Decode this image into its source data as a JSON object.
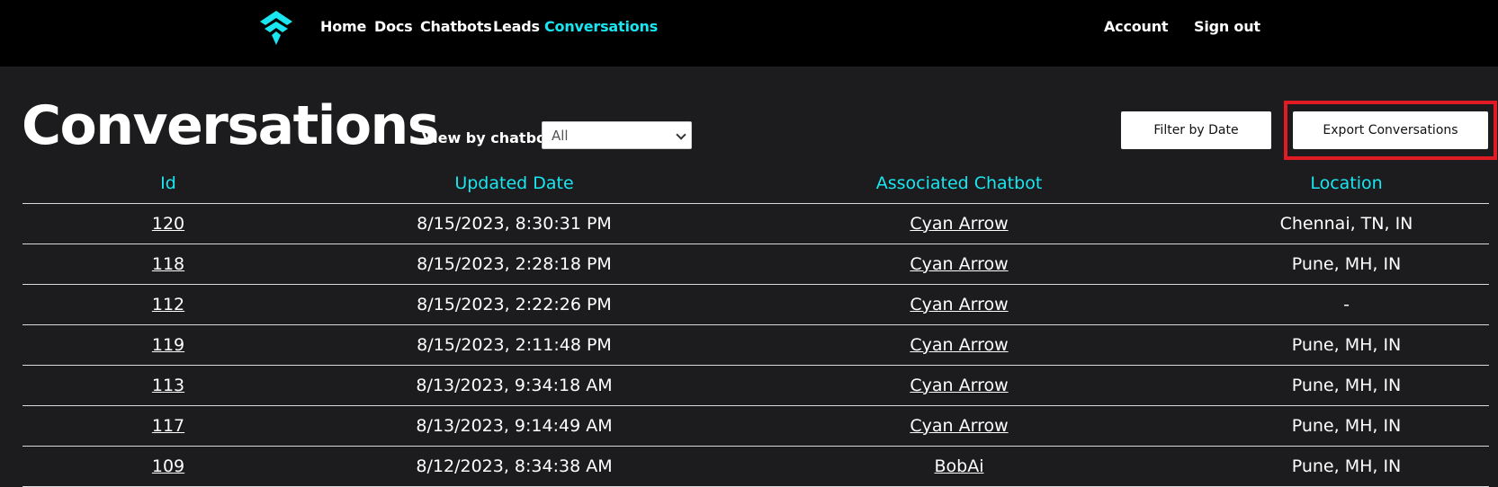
{
  "nav": {
    "links": [
      {
        "label": "Home",
        "active": false
      },
      {
        "label": "Docs",
        "active": false
      },
      {
        "label": "Chatbots",
        "active": false
      },
      {
        "label": "Leads",
        "active": false
      },
      {
        "label": "Conversations",
        "active": true
      }
    ],
    "account_label": "Account",
    "signout_label": "Sign out",
    "logo_icon": "arrow-logo-icon"
  },
  "page": {
    "title": "Conversations",
    "view_by_label": "View by chatbot",
    "chatbot_select_value": "All",
    "filter_button_label": "Filter by Date",
    "export_button_label": "Export Conversations"
  },
  "table": {
    "headers": [
      "Id",
      "Updated Date",
      "Associated Chatbot",
      "Location"
    ],
    "rows": [
      {
        "id": "120",
        "updated": "8/15/2023, 8:30:31 PM",
        "chatbot": "Cyan Arrow",
        "location": "Chennai, TN, IN"
      },
      {
        "id": "118",
        "updated": "8/15/2023, 2:28:18 PM",
        "chatbot": "Cyan Arrow",
        "location": "Pune, MH, IN"
      },
      {
        "id": "112",
        "updated": "8/15/2023, 2:22:26 PM",
        "chatbot": "Cyan Arrow",
        "location": "-"
      },
      {
        "id": "119",
        "updated": "8/15/2023, 2:11:48 PM",
        "chatbot": "Cyan Arrow",
        "location": "Pune, MH, IN"
      },
      {
        "id": "113",
        "updated": "8/13/2023, 9:34:18 AM",
        "chatbot": "Cyan Arrow",
        "location": "Pune, MH, IN"
      },
      {
        "id": "117",
        "updated": "8/13/2023, 9:14:49 AM",
        "chatbot": "Cyan Arrow",
        "location": "Pune, MH, IN"
      },
      {
        "id": "109",
        "updated": "8/12/2023, 8:34:38 AM",
        "chatbot": "BobAi",
        "location": "Pune, MH, IN"
      }
    ]
  },
  "colors": {
    "accent": "#19e6f0",
    "background": "#1c1c1e",
    "nav_background": "#000000",
    "highlight": "#e01b24"
  }
}
